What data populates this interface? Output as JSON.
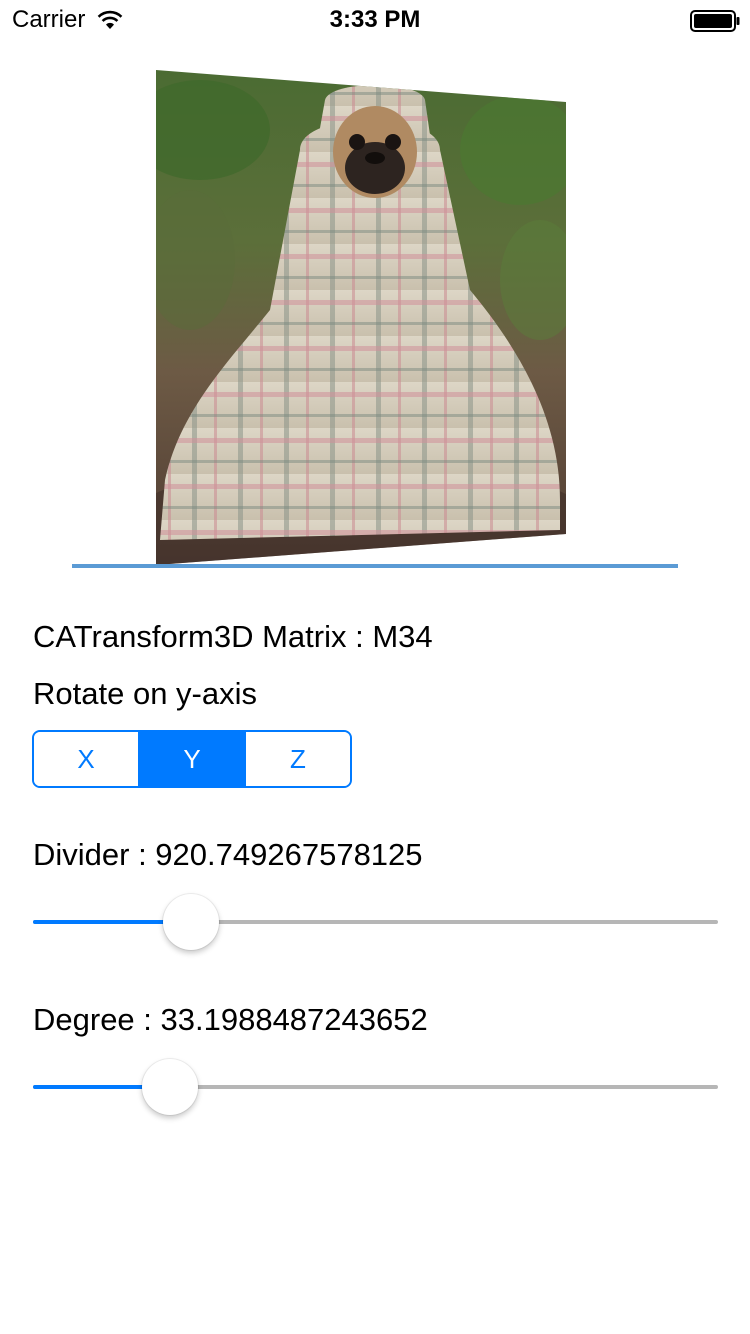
{
  "status_bar": {
    "carrier": "Carrier",
    "time": "3:33 PM"
  },
  "photo": {
    "subject": "pug wrapped in a plaid blanket in a forest"
  },
  "labels": {
    "matrix": "CATransform3D Matrix : M34",
    "rotate": "Rotate on y-axis"
  },
  "axis_control": {
    "segments": [
      "X",
      "Y",
      "Z"
    ],
    "selected_index": 1
  },
  "divider_slider": {
    "label": "Divider : 920.749267578125",
    "fraction": 0.23
  },
  "degree_slider": {
    "label": "Degree : 33.1988487243652",
    "fraction": 0.2
  },
  "colors": {
    "accent": "#007aff",
    "divider_line": "#5b9bd5",
    "track": "#b6b6b6"
  }
}
